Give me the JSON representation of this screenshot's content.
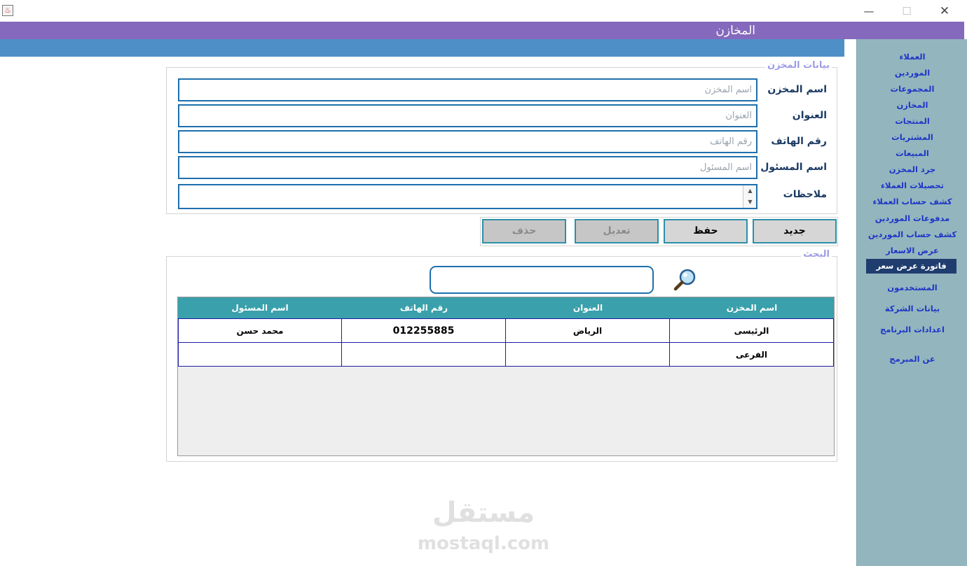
{
  "window": {
    "title": "المخازن",
    "min_glyph": "—",
    "max_glyph": "☐",
    "close_glyph": "✕",
    "app_icon_glyph": "♨"
  },
  "sidebar": {
    "items": [
      {
        "label": "العملاء"
      },
      {
        "label": "الموردين"
      },
      {
        "label": "المجموعات"
      },
      {
        "label": "المخازن"
      },
      {
        "label": "المنتجات"
      },
      {
        "label": "المشتريات"
      },
      {
        "label": "المبيعات"
      },
      {
        "label": "جرد المخزن"
      },
      {
        "label": "تحصيلات العملاء"
      },
      {
        "label": "كشف حساب العملاء"
      },
      {
        "label": "مدفوعات  الموردين"
      },
      {
        "label": "كشف حساب  الموردين"
      },
      {
        "label": "عرض الاسعار"
      },
      {
        "label": "فاتورة عرض سعر",
        "active": true
      },
      {
        "label": "المستخدمون"
      },
      {
        "label": "بيانات الشركة"
      },
      {
        "label": "اعدادات البرنامج"
      },
      {
        "label": "عن المبرمج"
      }
    ]
  },
  "form": {
    "legend": "بيانات المخزن",
    "fields": [
      {
        "label": "اسم المخزن",
        "placeholder": "اسم المخزن",
        "value": ""
      },
      {
        "label": "العنوان",
        "placeholder": "العنوان",
        "value": ""
      },
      {
        "label": "رقم الهاتف",
        "placeholder": "رقم الهاتف",
        "value": ""
      },
      {
        "label": "اسم المسئول",
        "placeholder": "اسم المسئول",
        "value": ""
      }
    ],
    "notes_label": "ملاحظات",
    "notes_value": ""
  },
  "buttons": {
    "new": "جديد",
    "save": "حفظ",
    "edit": "تعديل",
    "delete": "حذف"
  },
  "search": {
    "legend": "البحث",
    "value": ""
  },
  "table": {
    "headers": [
      "اسم المخزن",
      "العنوان",
      "رقم الهاتف",
      "اسم المسئول"
    ],
    "rows": [
      [
        "الرئيسى",
        "الرياض",
        "012255885",
        "محمد حسن"
      ],
      [
        "الفرعى",
        "",
        "",
        ""
      ]
    ]
  },
  "watermark": {
    "word": "مستقل",
    "url": "mostaql.com"
  },
  "colors": {
    "title_bar": "#8469bd",
    "header_bar": "#4f8fc7",
    "sidebar": "#93b6be",
    "table_header": "#3aa0ab",
    "active_item": "#1f3d6e"
  }
}
